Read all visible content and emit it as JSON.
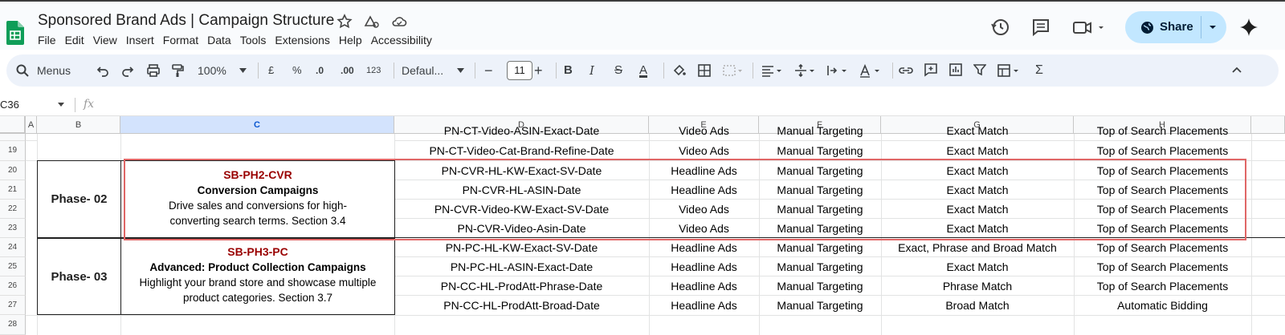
{
  "doc": {
    "title": "Sponsored Brand Ads | Campaign Structure",
    "menu": [
      "File",
      "Edit",
      "View",
      "Insert",
      "Format",
      "Data",
      "Tools",
      "Extensions",
      "Help",
      "Accessibility"
    ],
    "share_label": "Share"
  },
  "toolbar": {
    "search_label": "Menus",
    "zoom": "100%",
    "currency": "£",
    "percent": "%",
    "dec_decrease": ".0",
    "dec_increase": ".00",
    "number_format": "123",
    "font": "Defaul...",
    "font_size": "11",
    "bold": "B",
    "italic": "I",
    "strike": "S",
    "text_color": "A"
  },
  "formula_bar": {
    "name_box": "C36",
    "fx": "fx"
  },
  "columns": [
    "A",
    "B",
    "C",
    "D",
    "E",
    "F",
    "G",
    "H"
  ],
  "selected_column": "C",
  "row_numbers": [
    "19",
    "20",
    "21",
    "22",
    "23",
    "24",
    "25",
    "26",
    "27",
    "28"
  ],
  "partial_row": [
    "PN-CT-Video-ASIN-Exact-Date",
    "Video Ads",
    "Manual Targeting",
    "Exact Match",
    "Top of Search Placements"
  ],
  "rows": [
    [
      "PN-CT-Video-Cat-Brand-Refine-Date",
      "Video Ads",
      "Manual Targeting",
      "Exact Match",
      "Top of Search Placements"
    ],
    [
      "PN-CVR-HL-KW-Exact-SV-Date",
      "Headline Ads",
      "Manual Targeting",
      "Exact Match",
      "Top of Search Placements"
    ],
    [
      "PN-CVR-HL-ASIN-Date",
      "Headline Ads",
      "Manual Targeting",
      "Exact Match",
      "Top of Search Placements"
    ],
    [
      "PN-CVR-Video-KW-Exact-SV-Date",
      "Video Ads",
      "Manual Targeting",
      "Exact Match",
      "Top of Search Placements"
    ],
    [
      "PN-CVR-Video-Asin-Date",
      "Video Ads",
      "Manual Targeting",
      "Exact Match",
      "Top of Search Placements"
    ],
    [
      "PN-PC-HL-KW-Exact-SV-Date",
      "Headline Ads",
      "Manual Targeting",
      "Exact, Phrase and Broad Match",
      "Top of Search Placements"
    ],
    [
      "PN-PC-HL-ASIN-Exact-Date",
      "Headline Ads",
      "Manual Targeting",
      "Exact Match",
      "Top of Search Placements"
    ],
    [
      "PN-CC-HL-ProdAtt-Phrase-Date",
      "Headline Ads",
      "Manual Targeting",
      "Phrase Match",
      "Top of Search Placements"
    ],
    [
      "PN-CC-HL-ProdAtt-Broad-Date",
      "Headline Ads",
      "Manual Targeting",
      "Broad Match",
      "Automatic Bidding"
    ]
  ],
  "phases": [
    {
      "label": "Phase- 02",
      "code": "SB-PH2-CVR",
      "name": "Conversion Campaigns",
      "desc1": "Drive sales and conversions for high-",
      "desc2": "converting search terms. Section 3.4"
    },
    {
      "label": "Phase- 03",
      "code": "SB-PH3-PC",
      "name": "Advanced: Product Collection Campaigns",
      "desc1": "Highlight your brand store and showcase multiple",
      "desc2": "product categories. Section 3.7"
    }
  ],
  "colors": {
    "accent": "#c2e7ff",
    "code_red": "#990000",
    "highlight": "#e06666",
    "sheets_green": "#0f9d58"
  }
}
